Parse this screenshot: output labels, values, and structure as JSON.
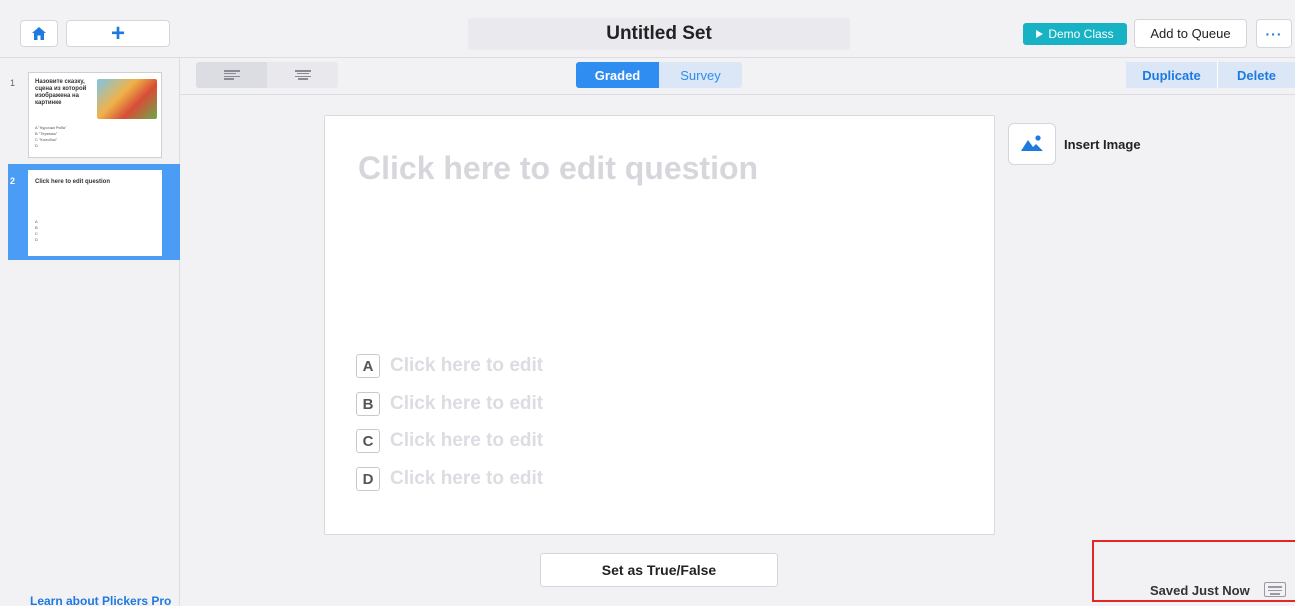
{
  "header": {
    "title": "Untitled Set",
    "demo_class_label": "Demo Class",
    "add_to_queue_label": "Add to Queue",
    "more_label": "···",
    "plus_label": "+"
  },
  "sidebar": {
    "slides": [
      {
        "number": "1",
        "question": "Назовите сказку, сцена из которой изображена на картинке",
        "answers": [
          "A  \"Курочка Ряба\"",
          "B  \"Теремок\"",
          "C  \"Колобок\"",
          "D"
        ]
      },
      {
        "number": "2",
        "question": "Click here to edit question",
        "answers": [
          "A",
          "B",
          "C",
          "D"
        ]
      }
    ],
    "learn_link": "Learn about Plickers Pro"
  },
  "toolbar": {
    "graded_label": "Graded",
    "survey_label": "Survey",
    "duplicate_label": "Duplicate",
    "delete_label": "Delete"
  },
  "editor": {
    "question_placeholder": "Click here to edit question",
    "choices": [
      {
        "letter": "A",
        "text": "Click here to edit"
      },
      {
        "letter": "B",
        "text": "Click here to edit"
      },
      {
        "letter": "C",
        "text": "Click here to edit"
      },
      {
        "letter": "D",
        "text": "Click here to edit"
      }
    ],
    "insert_image_label": "Insert Image",
    "true_false_label": "Set as True/False"
  },
  "status": {
    "saved_text": "Saved Just Now"
  },
  "colors": {
    "accent": "#2f8cf0",
    "demo_class": "#17b3c4",
    "selected_slide": "#4a9cf5",
    "highlight_box": "#e32626"
  }
}
